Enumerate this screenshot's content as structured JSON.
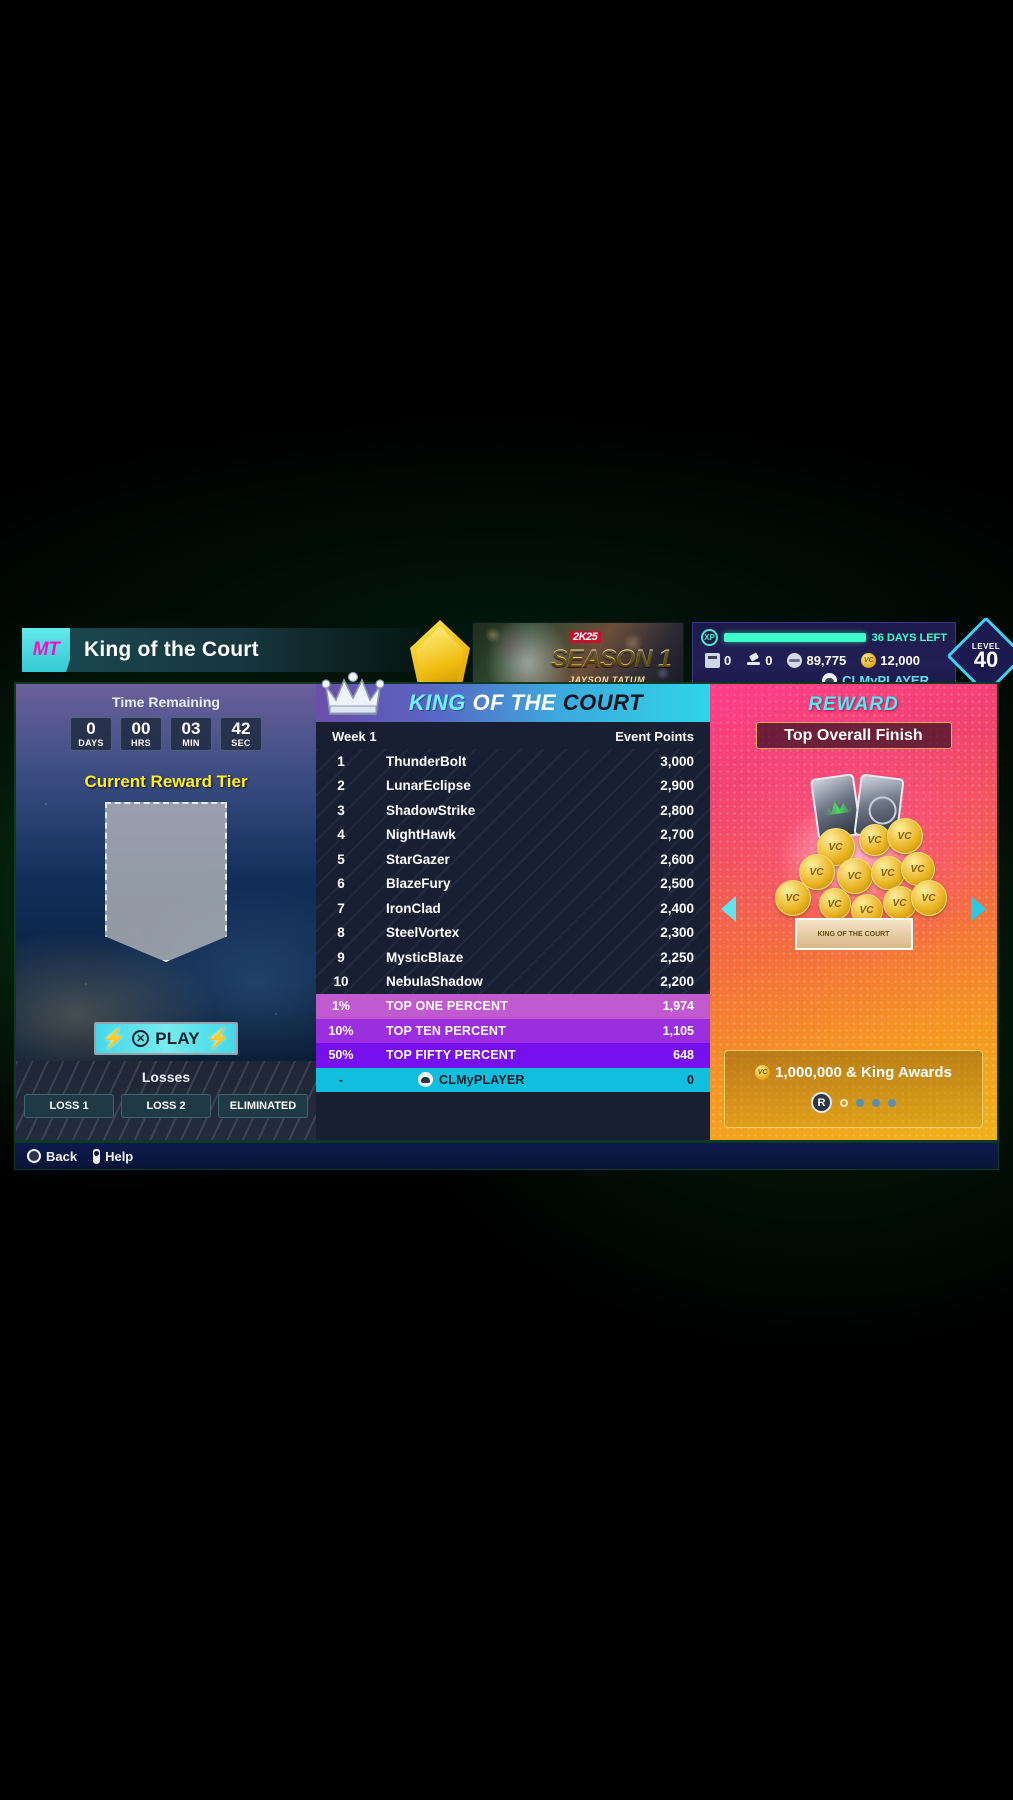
{
  "header": {
    "mt_badge": "MT",
    "title": "King of the Court",
    "season": {
      "logo": "2K25",
      "name": "SEASON 1",
      "athlete": "JAYSON TATUM"
    },
    "currency": {
      "days_left": "36 DAYS LEFT",
      "tickets": "0",
      "auction": "0",
      "mt": "89,775",
      "vc": "12,000",
      "username": "CLMyPLAYER",
      "level_label": "LEVEL",
      "level_value": "40"
    }
  },
  "left_panel": {
    "time_remaining_label": "Time Remaining",
    "timer": [
      {
        "value": "0",
        "unit": "DAYS"
      },
      {
        "value": "00",
        "unit": "HRS"
      },
      {
        "value": "03",
        "unit": "MIN"
      },
      {
        "value": "42",
        "unit": "SEC"
      }
    ],
    "current_reward_tier_label": "Current Reward Tier",
    "play_label": "PLAY",
    "losses_label": "Losses",
    "loss_chips": [
      "LOSS 1",
      "LOSS 2",
      "ELIMINATED"
    ]
  },
  "leaderboard": {
    "title_part1": "KING",
    "title_part2": "OF THE",
    "title_part3": "COURT",
    "col_week": "Week 1",
    "col_points": "Event Points",
    "rows": [
      {
        "rank": "1",
        "name": "ThunderBolt",
        "points": "3,000"
      },
      {
        "rank": "2",
        "name": "LunarEclipse",
        "points": "2,900"
      },
      {
        "rank": "3",
        "name": "ShadowStrike",
        "points": "2,800"
      },
      {
        "rank": "4",
        "name": "NightHawk",
        "points": "2,700"
      },
      {
        "rank": "5",
        "name": "StarGazer",
        "points": "2,600"
      },
      {
        "rank": "6",
        "name": "BlazeFury",
        "points": "2,500"
      },
      {
        "rank": "7",
        "name": "IronClad",
        "points": "2,400"
      },
      {
        "rank": "8",
        "name": "SteelVortex",
        "points": "2,300"
      },
      {
        "rank": "9",
        "name": "MysticBlaze",
        "points": "2,250"
      },
      {
        "rank": "10",
        "name": "NebulaShadow",
        "points": "2,200"
      }
    ],
    "tiers": [
      {
        "rank": "1%",
        "name": "TOP ONE PERCENT",
        "points": "1,974",
        "color": "#c15ad0"
      },
      {
        "rank": "10%",
        "name": "TOP TEN PERCENT",
        "points": "1,105",
        "color": "#9b2fe0"
      },
      {
        "rank": "50%",
        "name": "TOP FIFTY PERCENT",
        "points": "648",
        "color": "#7610ef"
      },
      {
        "rank": "-",
        "name": "CLMyPLAYER",
        "points": "0",
        "color": "#12bede"
      }
    ]
  },
  "reward": {
    "title": "REWARD",
    "subtitle": "Top Overall Finish",
    "banner_text": "KING OF THE COURT",
    "amount": "1,000,000 & King Awards",
    "pager_button": "R",
    "page_count": 4,
    "active_page": 0
  },
  "footer": {
    "back": "Back",
    "help": "Help"
  },
  "colors": {
    "accent_cyan": "#4beef6",
    "accent_magenta": "#f112c8",
    "tier_gold": "#edb21a",
    "yellow": "#ffef23"
  }
}
